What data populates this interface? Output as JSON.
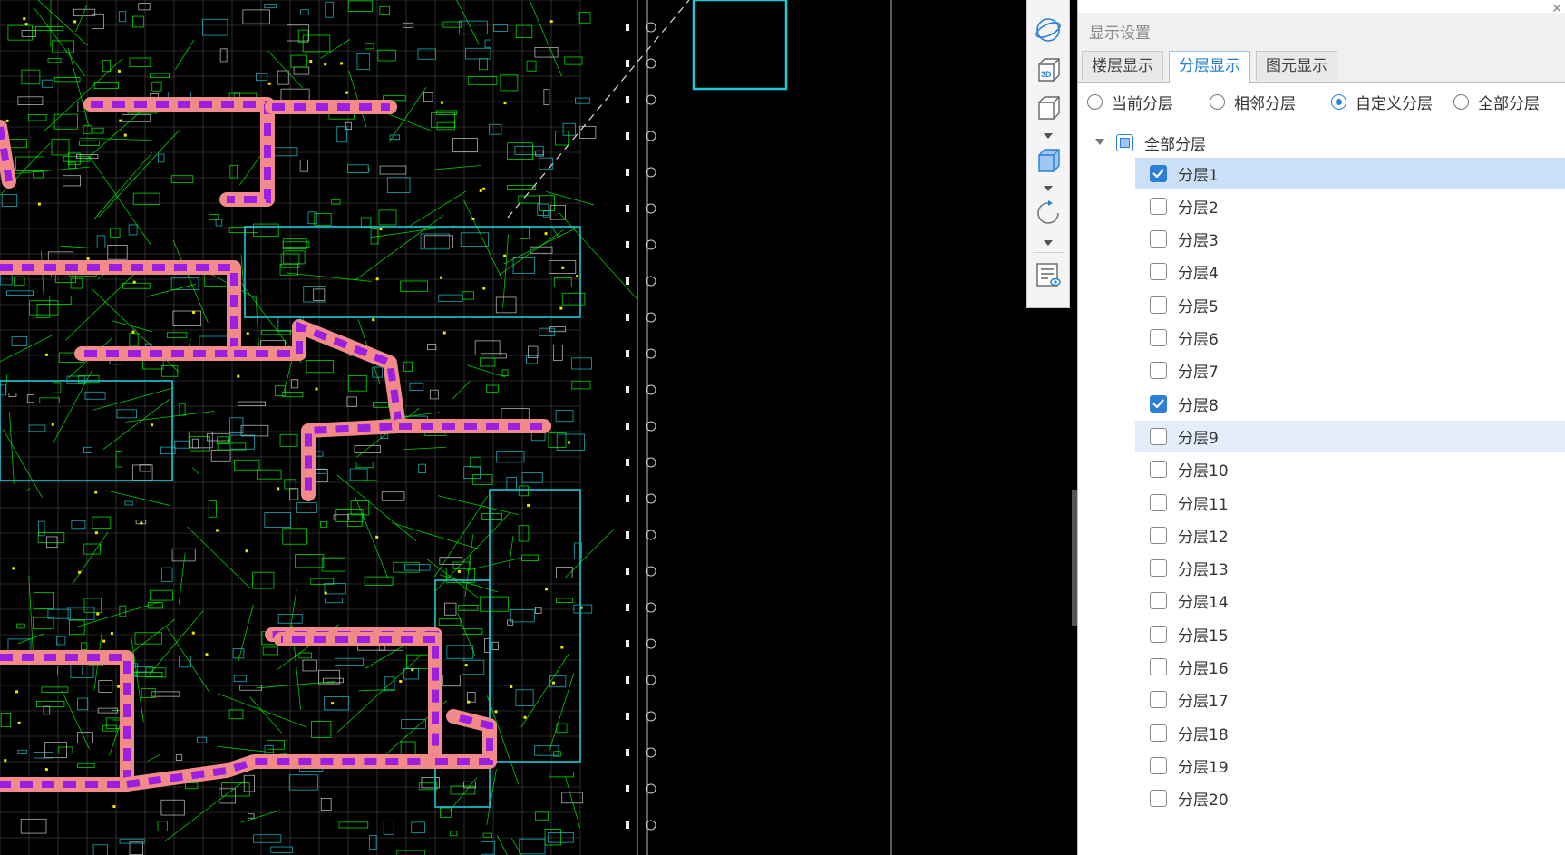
{
  "panel": {
    "title": "显示设置",
    "close_icon": "close-icon"
  },
  "tabs": [
    {
      "label": "楼层显示",
      "active": false
    },
    {
      "label": "分层显示",
      "active": true
    },
    {
      "label": "图元显示",
      "active": false
    }
  ],
  "radios": [
    {
      "label": "当前分层",
      "checked": false
    },
    {
      "label": "相邻分层",
      "checked": false
    },
    {
      "label": "自定义分层",
      "checked": true
    },
    {
      "label": "全部分层",
      "checked": false
    }
  ],
  "tree": {
    "root": {
      "label": "全部分层",
      "state": "partial",
      "expanded": true
    },
    "items": [
      {
        "label": "分层1",
        "checked": true,
        "row_state": "selected"
      },
      {
        "label": "分层2",
        "checked": false,
        "row_state": ""
      },
      {
        "label": "分层3",
        "checked": false,
        "row_state": ""
      },
      {
        "label": "分层4",
        "checked": false,
        "row_state": ""
      },
      {
        "label": "分层5",
        "checked": false,
        "row_state": ""
      },
      {
        "label": "分层6",
        "checked": false,
        "row_state": ""
      },
      {
        "label": "分层7",
        "checked": false,
        "row_state": ""
      },
      {
        "label": "分层8",
        "checked": true,
        "row_state": ""
      },
      {
        "label": "分层9",
        "checked": false,
        "row_state": "hover"
      },
      {
        "label": "分层10",
        "checked": false,
        "row_state": ""
      },
      {
        "label": "分层11",
        "checked": false,
        "row_state": ""
      },
      {
        "label": "分层12",
        "checked": false,
        "row_state": ""
      },
      {
        "label": "分层13",
        "checked": false,
        "row_state": ""
      },
      {
        "label": "分层14",
        "checked": false,
        "row_state": ""
      },
      {
        "label": "分层15",
        "checked": false,
        "row_state": ""
      },
      {
        "label": "分层16",
        "checked": false,
        "row_state": ""
      },
      {
        "label": "分层17",
        "checked": false,
        "row_state": ""
      },
      {
        "label": "分层18",
        "checked": false,
        "row_state": ""
      },
      {
        "label": "分层19",
        "checked": false,
        "row_state": ""
      },
      {
        "label": "分层20",
        "checked": false,
        "row_state": ""
      }
    ]
  },
  "toolbar": {
    "icons": [
      "orbit-icon",
      "3d-view-icon",
      "front-view-icon",
      "iso-view-icon",
      "rotate-icon",
      "display-settings-icon"
    ],
    "three_d_text": "3D"
  },
  "colors": {
    "accent": "#2b7fd7",
    "cad_background": "#000000",
    "duct_fill": "#f28a8a",
    "duct_segment": "#9b1fe0",
    "line_green": "#00ff00",
    "line_cyan": "#1ec8d8",
    "line_gray": "#8c8c8c"
  }
}
